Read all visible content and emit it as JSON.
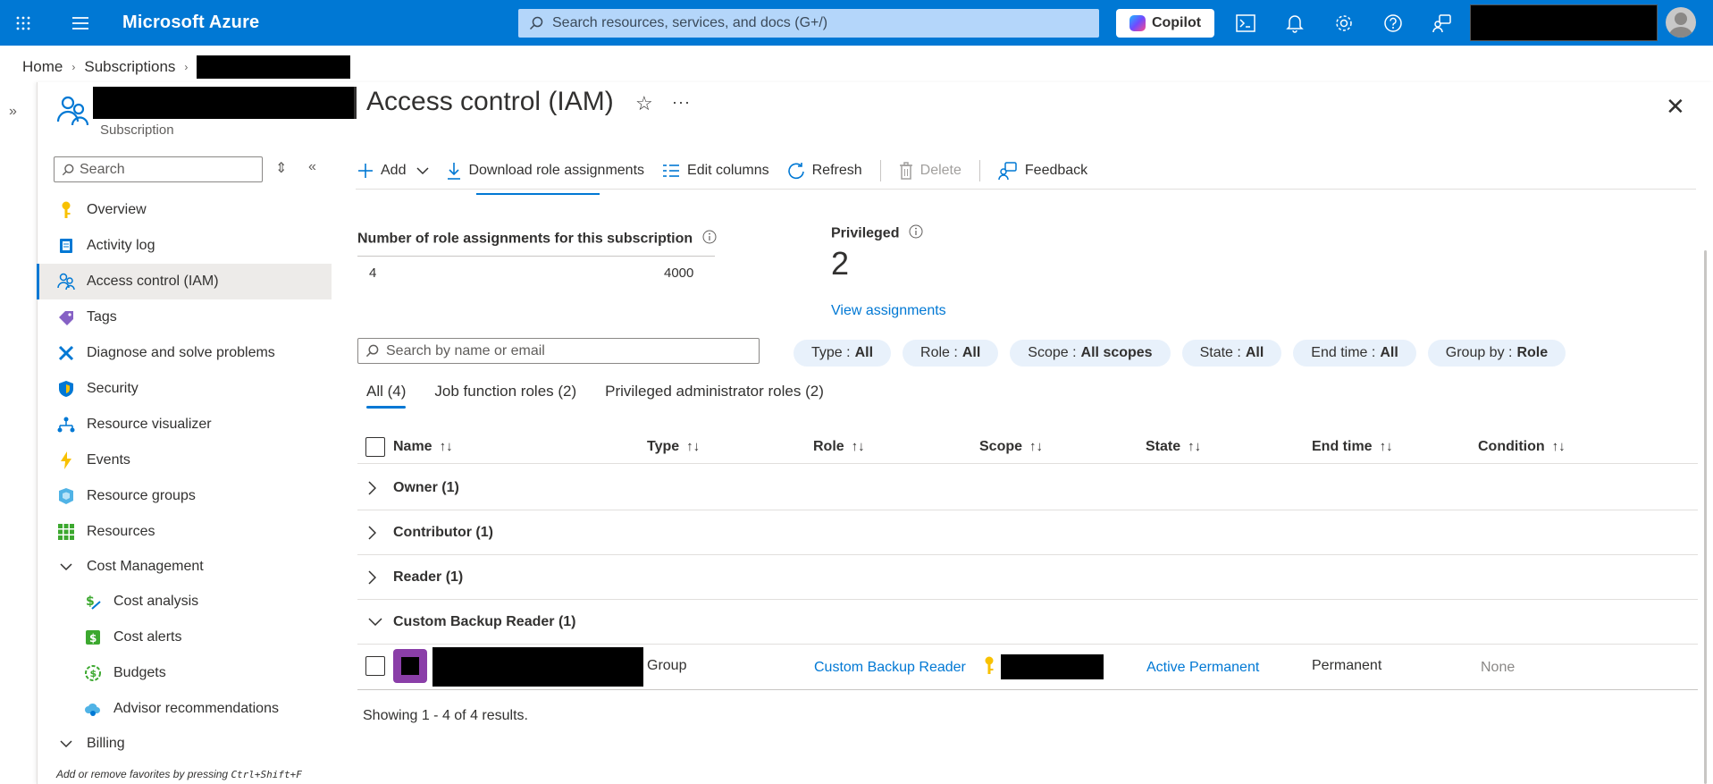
{
  "topbar": {
    "brand": "Microsoft Azure",
    "search_placeholder": "Search resources, services, and docs (G+/)",
    "copilot_label": "Copilot"
  },
  "breadcrumb": {
    "home": "Home",
    "subscriptions": "Subscriptions"
  },
  "page": {
    "title": "Access control (IAM)",
    "subtitle": "Subscription"
  },
  "sidebar": {
    "search_placeholder": "Search",
    "items": [
      {
        "label": "Overview",
        "icon": "key-icon"
      },
      {
        "label": "Activity log",
        "icon": "activity-log-icon"
      },
      {
        "label": "Access control (IAM)",
        "icon": "people-icon",
        "active": true
      },
      {
        "label": "Tags",
        "icon": "tag-icon"
      },
      {
        "label": "Diagnose and solve problems",
        "icon": "wrench-icon"
      },
      {
        "label": "Security",
        "icon": "shield-icon"
      },
      {
        "label": "Resource visualizer",
        "icon": "hierarchy-icon"
      },
      {
        "label": "Events",
        "icon": "lightning-icon"
      },
      {
        "label": "Resource groups",
        "icon": "cube-icon"
      },
      {
        "label": "Resources",
        "icon": "grid-icon"
      },
      {
        "label": "Cost Management",
        "icon": "chevron-down-icon",
        "group": true
      },
      {
        "label": "Cost analysis",
        "icon": "dollar-chart-icon",
        "sub": true
      },
      {
        "label": "Cost alerts",
        "icon": "dollar-alert-icon",
        "sub": true
      },
      {
        "label": "Budgets",
        "icon": "budget-icon",
        "sub": true
      },
      {
        "label": "Advisor recommendations",
        "icon": "cloud-advisor-icon",
        "sub": true
      },
      {
        "label": "Billing",
        "icon": "chevron-down-icon",
        "group": true
      }
    ],
    "fav_hint_text": "Add or remove favorites by pressing",
    "fav_hint_keys": "Ctrl+Shift+F"
  },
  "toolbar": {
    "add": "Add",
    "download": "Download role assignments",
    "edit_columns": "Edit columns",
    "refresh": "Refresh",
    "delete": "Delete",
    "feedback": "Feedback"
  },
  "stats": {
    "assignments_label": "Number of role assignments for this subscription",
    "current": "4",
    "max": "4000",
    "privileged_label": "Privileged",
    "privileged_value": "2",
    "view_assignments": "View assignments"
  },
  "filters": {
    "search_placeholder": "Search by name or email",
    "pills": [
      {
        "key": "Type :",
        "value": "All"
      },
      {
        "key": "Role :",
        "value": "All"
      },
      {
        "key": "Scope :",
        "value": "All scopes"
      },
      {
        "key": "State :",
        "value": "All"
      },
      {
        "key": "End time :",
        "value": "All"
      },
      {
        "key": "Group by :",
        "value": "Role"
      }
    ]
  },
  "tabs": [
    {
      "label": "All (4)",
      "active": true
    },
    {
      "label": "Job function roles (2)"
    },
    {
      "label": "Privileged administrator roles (2)"
    }
  ],
  "table": {
    "columns": [
      "Name",
      "Type",
      "Role",
      "Scope",
      "State",
      "End time",
      "Condition"
    ],
    "groups": [
      "Owner (1)",
      "Contributor (1)",
      "Reader (1)",
      "Custom Backup Reader (1)"
    ],
    "row": {
      "type": "Group",
      "role": "Custom Backup Reader",
      "state": "Active Permanent",
      "end_time": "Permanent",
      "condition": "None"
    },
    "showing": "Showing 1 - 4 of 4 results."
  },
  "colors": {
    "accent": "#0078d4",
    "topbar": "#0078d4",
    "pill_bg": "#e8f1fb"
  }
}
